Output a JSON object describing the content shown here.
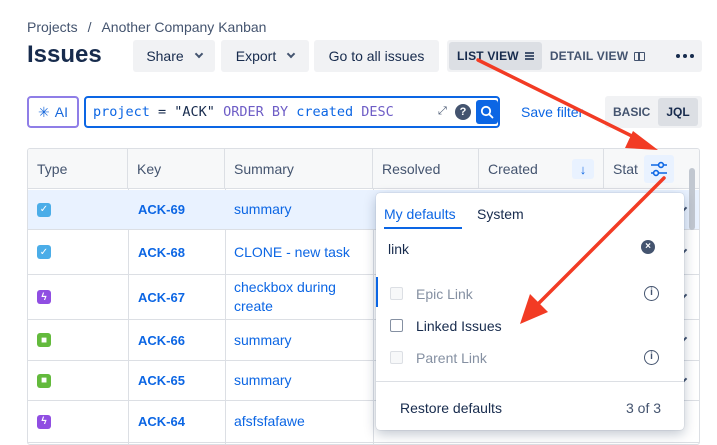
{
  "breadcrumb": {
    "root": "Projects",
    "separator": "/",
    "current": "Another Company Kanban"
  },
  "page_title": "Issues",
  "header": {
    "share_label": "Share",
    "export_label": "Export",
    "goto_all_label": "Go to all issues",
    "list_view_label": "LIST VIEW",
    "detail_view_label": "DETAIL VIEW"
  },
  "search": {
    "ai_label": "AI",
    "jql_field": "project",
    "jql_op": " = ",
    "jql_value": "\"ACK\"",
    "jql_order": " ORDER BY ",
    "jql_sort_field": "created",
    "jql_dir": " DESC",
    "help_label": "?",
    "save_filter_label": "Save filter",
    "basic_label": "BASIC",
    "jql_label": "JQL"
  },
  "table": {
    "columns": [
      "Type",
      "Key",
      "Summary",
      "Resolved",
      "Created",
      "Stat"
    ],
    "rows": [
      {
        "type": "task",
        "key": "ACK-69",
        "summary": "summary"
      },
      {
        "type": "task",
        "key": "ACK-68",
        "summary": "CLONE - new task"
      },
      {
        "type": "subtask",
        "key": "ACK-67",
        "summary": "checkbox during create"
      },
      {
        "type": "story",
        "key": "ACK-66",
        "summary": "summary"
      },
      {
        "type": "story",
        "key": "ACK-65",
        "summary": "summary"
      },
      {
        "type": "subtask",
        "key": "ACK-64",
        "summary": "afsfsfafawe"
      }
    ]
  },
  "column_picker": {
    "tab_my_defaults": "My defaults",
    "tab_system": "System",
    "search_value": "link",
    "options": [
      {
        "label": "Epic Link",
        "checked": false,
        "disabled": true,
        "info": true
      },
      {
        "label": "Linked Issues",
        "checked": false,
        "disabled": false,
        "info": false
      },
      {
        "label": "Parent Link",
        "checked": false,
        "disabled": true,
        "info": true
      }
    ],
    "restore_label": "Restore defaults",
    "count_label": "3 of 3"
  },
  "colors": {
    "accent": "#0c66e4",
    "annotation_arrow": "#f23b24"
  }
}
